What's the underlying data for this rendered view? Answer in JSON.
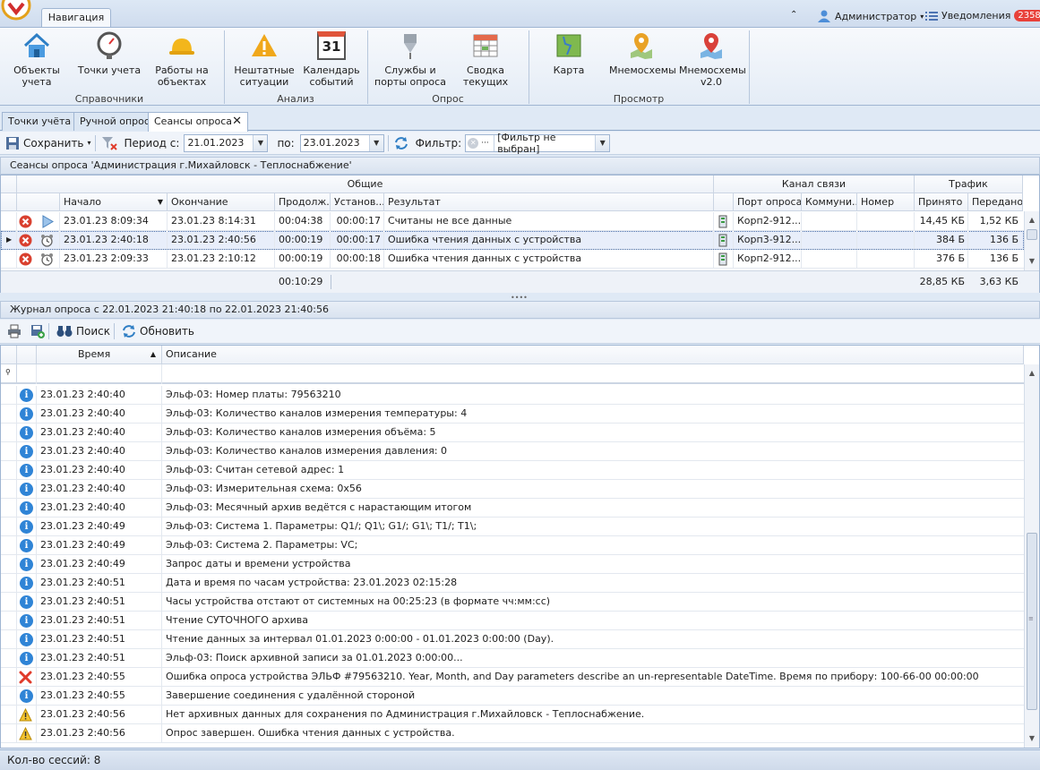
{
  "header": {
    "nav_tab": "Навигация",
    "user": "Администратор",
    "notifications_label": "Уведомления",
    "notifications_count": "2358"
  },
  "ribbon": {
    "groups": [
      {
        "label": "Справочники",
        "buttons": [
          "Объекты\nучета",
          "Точки учета",
          "Работы на\nобъектах"
        ]
      },
      {
        "label": "Анализ",
        "buttons": [
          "Нештатные\nситуации",
          "Календарь\nсобытий"
        ]
      },
      {
        "label": "Опрос",
        "buttons": [
          "Службы и\nпорты опроса",
          "Сводка\nтекущих"
        ]
      },
      {
        "label": "Просмотр",
        "buttons": [
          "Карта",
          "Мнемосхемы",
          "Мнемосхемы\nv2.0"
        ]
      }
    ],
    "calendar_day": "31"
  },
  "tabs": [
    "Точки учёта",
    "Ручной опрос",
    "Сеансы опроса"
  ],
  "toolbar": {
    "save_label": "Сохранить",
    "period_from_label": "Период с:",
    "period_from": "21.01.2023",
    "period_to_label": "по:",
    "period_to": "23.01.2023",
    "filter_label": "Фильтр:",
    "filter_value": "[Фильтр не выбран]"
  },
  "sessions": {
    "title": "Сеансы опроса 'Администрация г.Михайловск - Теплоснабжение'",
    "bands": [
      "Общие",
      "Канал связи",
      "Трафик"
    ],
    "columns": [
      "Начало",
      "Окончание",
      "Продолж...",
      "Установ...",
      "Результат",
      "Порт опроса",
      "Коммуни...",
      "Номер",
      "Принято",
      "Передано"
    ],
    "rows": [
      {
        "start": "23.01.23 8:09:34",
        "end": "23.01.23 8:14:31",
        "duration": "00:04:38",
        "setup": "00:00:17",
        "result": "Считаны не все данные",
        "port": "Корп2-912...",
        "comm": "",
        "number": "",
        "received": "14,45 КБ",
        "sent": "1,52 КБ",
        "kind": "play"
      },
      {
        "start": "23.01.23 2:40:18",
        "end": "23.01.23 2:40:56",
        "duration": "00:00:19",
        "setup": "00:00:17",
        "result": "Ошибка чтения данных с устройства",
        "port": "Корп3-912...",
        "comm": "",
        "number": "",
        "received": "384 Б",
        "sent": "136 Б",
        "kind": "clock"
      },
      {
        "start": "23.01.23 2:09:33",
        "end": "23.01.23 2:10:12",
        "duration": "00:00:19",
        "setup": "00:00:18",
        "result": "Ошибка чтения данных с устройства",
        "port": "Корп2-912...",
        "comm": "",
        "number": "",
        "received": "376 Б",
        "sent": "136 Б",
        "kind": "clock"
      }
    ],
    "totals": {
      "duration": "00:10:29",
      "received": "28,85 КБ",
      "sent": "3,63 КБ"
    }
  },
  "journal": {
    "title": "Журнал опроса с 22.01.2023 21:40:18 по 22.01.2023 21:40:56",
    "search_label": "Поиск",
    "refresh_label": "Обновить",
    "col_time": "Время",
    "col_desc": "Описание",
    "rows": [
      {
        "type": "info",
        "time": "23.01.23 2:40:40",
        "text": "Эльф-03: Номер платы: 79563210"
      },
      {
        "type": "info",
        "time": "23.01.23 2:40:40",
        "text": "Эльф-03: Количество каналов измерения температуры: 4"
      },
      {
        "type": "info",
        "time": "23.01.23 2:40:40",
        "text": "Эльф-03: Количество каналов измерения объёма: 5"
      },
      {
        "type": "info",
        "time": "23.01.23 2:40:40",
        "text": "Эльф-03: Количество каналов измерения давления: 0"
      },
      {
        "type": "info",
        "time": "23.01.23 2:40:40",
        "text": "Эльф-03: Считан сетевой адрес: 1"
      },
      {
        "type": "info",
        "time": "23.01.23 2:40:40",
        "text": "Эльф-03: Измерительная схема: 0x56"
      },
      {
        "type": "info",
        "time": "23.01.23 2:40:40",
        "text": "Эльф-03: Месячный архив ведётся с нарастающим итогом"
      },
      {
        "type": "info",
        "time": "23.01.23 2:40:49",
        "text": "Эльф-03: Система 1. Параметры: Q1/; Q1\\; G1/; G1\\; T1/; T1\\;"
      },
      {
        "type": "info",
        "time": "23.01.23 2:40:49",
        "text": "Эльф-03: Система 2. Параметры: VC;"
      },
      {
        "type": "info",
        "time": "23.01.23 2:40:49",
        "text": "Запрос даты и времени устройства"
      },
      {
        "type": "info",
        "time": "23.01.23 2:40:51",
        "text": "Дата и время по часам устройства: 23.01.2023 02:15:28"
      },
      {
        "type": "info",
        "time": "23.01.23 2:40:51",
        "text": "Часы устройства отстают от системных на 00:25:23 (в формате чч:мм:сс)"
      },
      {
        "type": "info",
        "time": "23.01.23 2:40:51",
        "text": "Чтение СУТОЧНОГО архива"
      },
      {
        "type": "info",
        "time": "23.01.23 2:40:51",
        "text": "Чтение данных за интервал 01.01.2023 0:00:00 - 01.01.2023 0:00:00 (Day)."
      },
      {
        "type": "info",
        "time": "23.01.23 2:40:51",
        "text": "Эльф-03: Поиск архивной записи за 01.01.2023 0:00:00..."
      },
      {
        "type": "error",
        "time": "23.01.23 2:40:55",
        "text": "Ошибка опроса устройства ЭЛЬФ #79563210. Year, Month, and Day parameters describe an un-representable DateTime. Время по прибору: 100-66-00 00:00:00"
      },
      {
        "type": "info",
        "time": "23.01.23 2:40:55",
        "text": "Завершение соединения с удалённой стороной"
      },
      {
        "type": "warning",
        "time": "23.01.23 2:40:56",
        "text": "Нет архивных данных для сохранения по Администрация г.Михайловск - Теплоснабжение."
      },
      {
        "type": "warning",
        "time": "23.01.23 2:40:56",
        "text": "Опрос завершен. Ошибка чтения данных с устройства."
      }
    ]
  },
  "status": "Кол-во сессий: 8",
  "colors": {
    "accent": "#2f84d6",
    "error": "#e03a2a",
    "badge": "#e8413a"
  }
}
